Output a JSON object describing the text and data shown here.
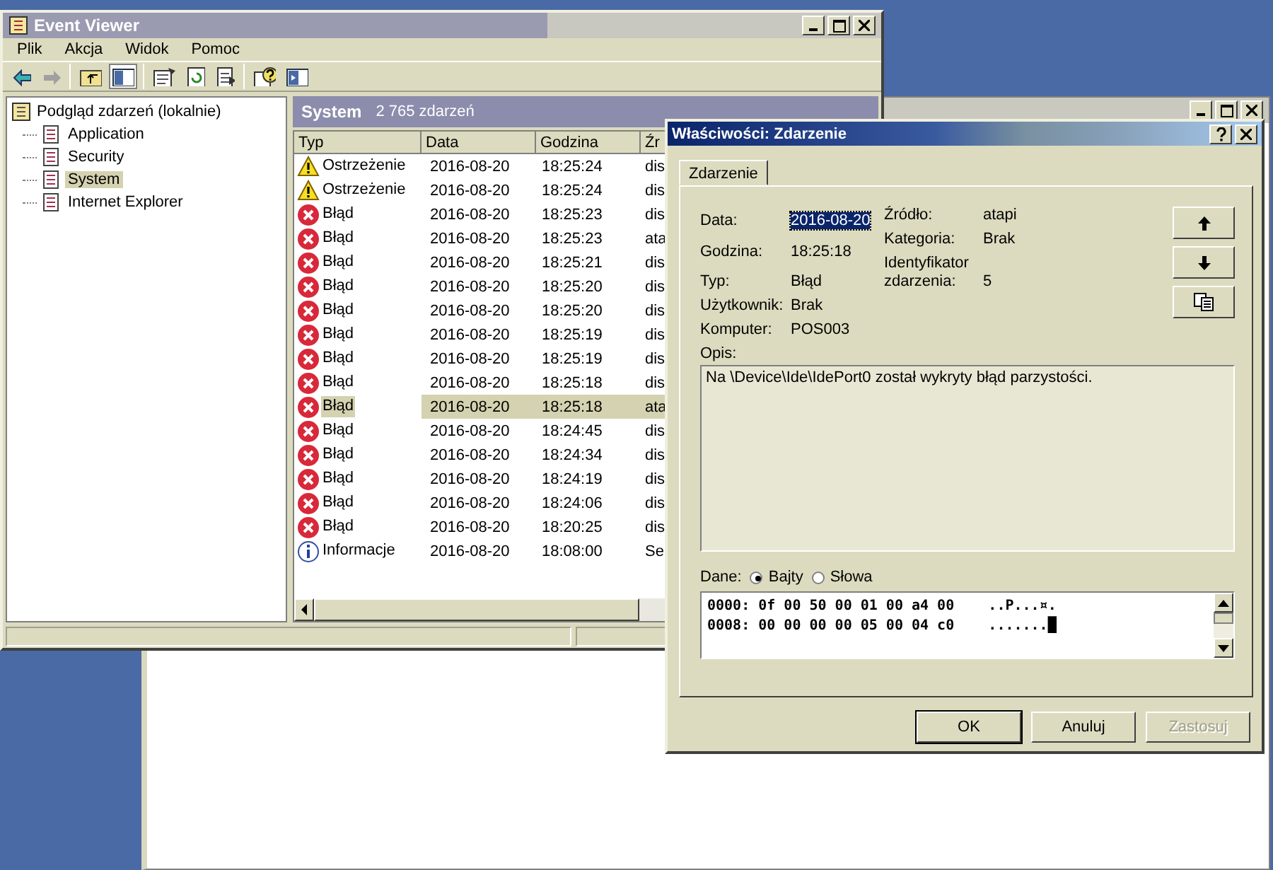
{
  "event_viewer": {
    "title": "Event Viewer",
    "menu": [
      "Plik",
      "Akcja",
      "Widok",
      "Pomoc"
    ],
    "tree": {
      "label": "Podgląd zdarzeń (lokalnie)",
      "children": [
        {
          "label": "Application",
          "selected": false
        },
        {
          "label": "Security",
          "selected": false
        },
        {
          "label": "System",
          "selected": true
        },
        {
          "label": "Internet Explorer",
          "selected": false
        }
      ]
    },
    "list_title": "System",
    "list_count": "2 765 zdarzeń",
    "table": {
      "columns": [
        "Typ",
        "Data",
        "Godzina",
        "Źr"
      ],
      "rows": [
        {
          "kind": "warning",
          "type": "Ostrzeżenie",
          "date": "2016-08-20",
          "time": "18:25:24",
          "column_4": "dis",
          "selected": false
        },
        {
          "kind": "warning",
          "type": "Ostrzeżenie",
          "date": "2016-08-20",
          "time": "18:25:24",
          "column_4": "dis",
          "selected": false
        },
        {
          "kind": "error",
          "type": "Błąd",
          "date": "2016-08-20",
          "time": "18:25:23",
          "column_4": "dis",
          "selected": false
        },
        {
          "kind": "error",
          "type": "Błąd",
          "date": "2016-08-20",
          "time": "18:25:23",
          "column_4": "ata",
          "selected": false
        },
        {
          "kind": "error",
          "type": "Błąd",
          "date": "2016-08-20",
          "time": "18:25:21",
          "column_4": "dis",
          "selected": false
        },
        {
          "kind": "error",
          "type": "Błąd",
          "date": "2016-08-20",
          "time": "18:25:20",
          "column_4": "dis",
          "selected": false
        },
        {
          "kind": "error",
          "type": "Błąd",
          "date": "2016-08-20",
          "time": "18:25:20",
          "column_4": "dis",
          "selected": false
        },
        {
          "kind": "error",
          "type": "Błąd",
          "date": "2016-08-20",
          "time": "18:25:19",
          "column_4": "dis",
          "selected": false
        },
        {
          "kind": "error",
          "type": "Błąd",
          "date": "2016-08-20",
          "time": "18:25:19",
          "column_4": "dis",
          "selected": false
        },
        {
          "kind": "error",
          "type": "Błąd",
          "date": "2016-08-20",
          "time": "18:25:18",
          "column_4": "dis",
          "selected": false
        },
        {
          "kind": "error",
          "type": "Błąd",
          "date": "2016-08-20",
          "time": "18:25:18",
          "column_4": "ata",
          "selected": true
        },
        {
          "kind": "error",
          "type": "Błąd",
          "date": "2016-08-20",
          "time": "18:24:45",
          "column_4": "dis",
          "selected": false
        },
        {
          "kind": "error",
          "type": "Błąd",
          "date": "2016-08-20",
          "time": "18:24:34",
          "column_4": "dis",
          "selected": false
        },
        {
          "kind": "error",
          "type": "Błąd",
          "date": "2016-08-20",
          "time": "18:24:19",
          "column_4": "dis",
          "selected": false
        },
        {
          "kind": "error",
          "type": "Błąd",
          "date": "2016-08-20",
          "time": "18:24:06",
          "column_4": "dis",
          "selected": false
        },
        {
          "kind": "error",
          "type": "Błąd",
          "date": "2016-08-20",
          "time": "18:20:25",
          "column_4": "dis",
          "selected": false
        },
        {
          "kind": "info",
          "type": "Informacje",
          "date": "2016-08-20",
          "time": "18:08:00",
          "column_4": "Se",
          "selected": false
        }
      ]
    }
  },
  "properties": {
    "title": "Właściwości: Zdarzenie",
    "tabs": [
      {
        "label": "Zdarzenie",
        "selected": true
      }
    ],
    "fields_left": [
      {
        "label": "Data:",
        "value": "2016-08-20",
        "highlighted": true
      },
      {
        "label": "Godzina:",
        "value": "18:25:18",
        "highlighted": false
      },
      {
        "label": "Typ:",
        "value": "Błąd",
        "highlighted": false
      }
    ],
    "fields_right": [
      {
        "label": "Źródło:",
        "value": "atapi"
      },
      {
        "label": "Kategoria:",
        "value": "Brak"
      },
      {
        "label": "Identyfikator zdarzenia:",
        "value": "5"
      }
    ],
    "fields_bottom": [
      {
        "label": "Użytkownik:",
        "value": "Brak"
      },
      {
        "label": "Komputer:",
        "value": "POS003"
      }
    ],
    "description_label": "Opis:",
    "description": "Na \\Device\\Ide\\IdePort0 został wykryty błąd parzystości.",
    "data_label": "Dane:",
    "data_formats": [
      {
        "label": "Bajty",
        "selected": true
      },
      {
        "label": "Słowa",
        "selected": false
      }
    ],
    "hex_lines": [
      "0000: 0f 00 50 00 01 00 a4 00    ..P...¤.",
      "0008: 00 00 00 00 05 00 04 c0    .......█"
    ],
    "buttons": [
      {
        "label": "OK",
        "disabled": false
      },
      {
        "label": "Anuluj",
        "disabled": false
      },
      {
        "label": "Zastosuj",
        "disabled": true
      }
    ]
  }
}
